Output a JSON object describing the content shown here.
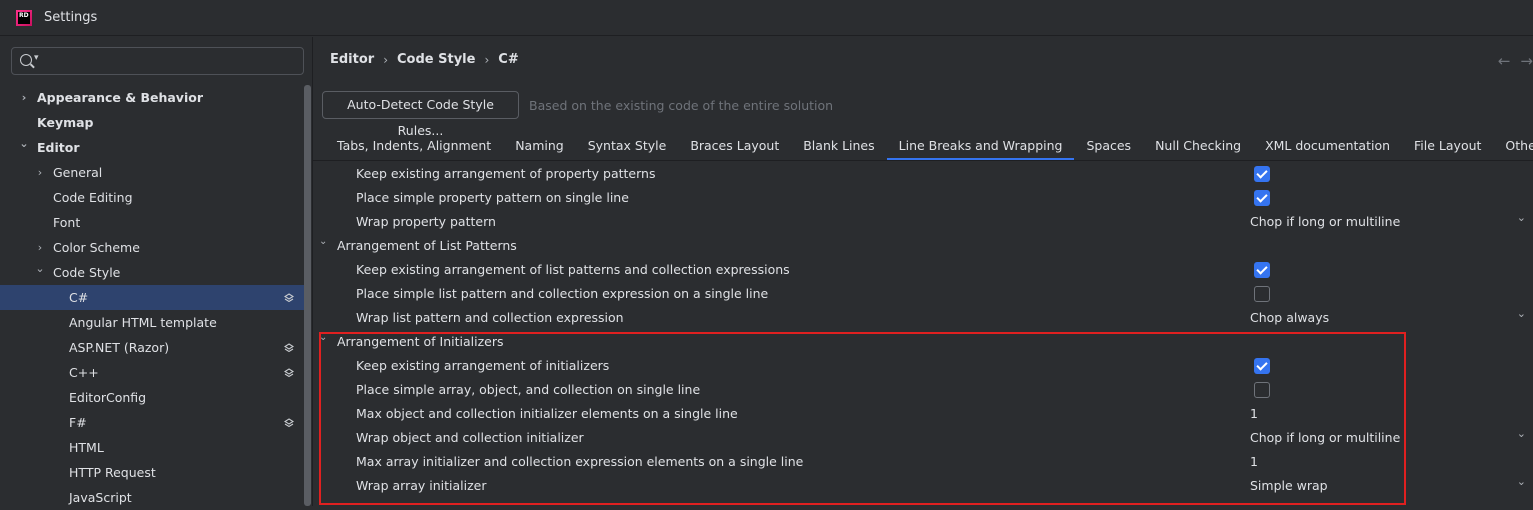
{
  "window": {
    "title": "Settings",
    "logo_text": "RD"
  },
  "sidebar": {
    "search": {
      "placeholder": ""
    },
    "items": [
      {
        "label": "Appearance & Behavior",
        "level": 0,
        "bold": true,
        "chevron": "right"
      },
      {
        "label": "Keymap",
        "level": 0,
        "bold": true,
        "chevron": ""
      },
      {
        "label": "Editor",
        "level": 0,
        "bold": true,
        "chevron": "down"
      },
      {
        "label": "General",
        "level": 1,
        "bold": false,
        "chevron": "right"
      },
      {
        "label": "Code Editing",
        "level": 1,
        "bold": false,
        "chevron": ""
      },
      {
        "label": "Font",
        "level": 1,
        "bold": false,
        "chevron": ""
      },
      {
        "label": "Color Scheme",
        "level": 1,
        "bold": false,
        "chevron": "right"
      },
      {
        "label": "Code Style",
        "level": 1,
        "bold": false,
        "chevron": "down"
      },
      {
        "label": "C#",
        "level": 2,
        "bold": false,
        "chevron": "",
        "selected": true,
        "layers": true
      },
      {
        "label": "Angular HTML template",
        "level": 2,
        "bold": false,
        "chevron": ""
      },
      {
        "label": "ASP.NET (Razor)",
        "level": 2,
        "bold": false,
        "chevron": "",
        "layers": true
      },
      {
        "label": "C++",
        "level": 2,
        "bold": false,
        "chevron": "",
        "layers": true
      },
      {
        "label": "EditorConfig",
        "level": 2,
        "bold": false,
        "chevron": ""
      },
      {
        "label": "F#",
        "level": 2,
        "bold": false,
        "chevron": "",
        "layers": true
      },
      {
        "label": "HTML",
        "level": 2,
        "bold": false,
        "chevron": ""
      },
      {
        "label": "HTTP Request",
        "level": 2,
        "bold": false,
        "chevron": ""
      },
      {
        "label": "JavaScript",
        "level": 2,
        "bold": false,
        "chevron": ""
      }
    ]
  },
  "breadcrumb": [
    "Editor",
    "Code Style",
    "C#"
  ],
  "nav": {
    "back": "←",
    "forward": "→"
  },
  "autodetect": {
    "button_label": "Auto-Detect Code Style Rules...",
    "hint": "Based on the existing code of the entire solution"
  },
  "tabs": [
    "Tabs, Indents, Alignment",
    "Naming",
    "Syntax Style",
    "Braces Layout",
    "Blank Lines",
    "Line Breaks and Wrapping",
    "Spaces",
    "Null Checking",
    "XML documentation",
    "File Layout",
    "Other"
  ],
  "active_tab": "Line Breaks and Wrapping",
  "settings_rows": [
    {
      "type": "checkbox",
      "label": "Keep existing arrangement of property patterns",
      "checked": true
    },
    {
      "type": "checkbox",
      "label": "Place simple property pattern on single line",
      "checked": true
    },
    {
      "type": "dropdown",
      "label": "Wrap property pattern",
      "value": "Chop if long or multiline"
    },
    {
      "type": "group",
      "label": "Arrangement of List Patterns"
    },
    {
      "type": "checkbox",
      "label": "Keep existing arrangement of list patterns and collection expressions",
      "checked": true
    },
    {
      "type": "checkbox",
      "label": "Place simple list pattern and collection expression on a single line",
      "checked": false
    },
    {
      "type": "dropdown",
      "label": "Wrap list pattern and collection expression",
      "value": "Chop always"
    },
    {
      "type": "group",
      "label": "Arrangement of Initializers"
    },
    {
      "type": "checkbox",
      "label": "Keep existing arrangement of initializers",
      "checked": true
    },
    {
      "type": "checkbox",
      "label": "Place simple array, object, and collection on single line",
      "checked": false
    },
    {
      "type": "number",
      "label": "Max object and collection initializer elements on a single line",
      "value": "1"
    },
    {
      "type": "dropdown",
      "label": "Wrap object and collection initializer",
      "value": "Chop if long or multiline"
    },
    {
      "type": "number",
      "label": "Max array initializer and collection expression elements on a single line",
      "value": "1"
    },
    {
      "type": "dropdown",
      "label": "Wrap array initializer",
      "value": "Simple wrap"
    }
  ],
  "colors": {
    "background": "#2b2d30",
    "selection": "#2e436e",
    "accent": "#3574f0",
    "highlight_box": "#e02020"
  }
}
